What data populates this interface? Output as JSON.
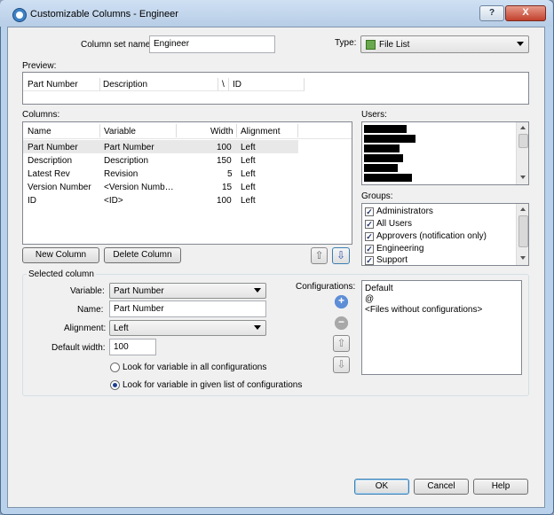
{
  "window": {
    "title": "Customizable Columns - Engineer",
    "help_glyph": "?",
    "close_glyph": "X"
  },
  "column_set": {
    "label": "Column set name:",
    "value": "Engineer"
  },
  "type": {
    "label": "Type:",
    "value": "File List",
    "icon": "file-list-icon"
  },
  "preview": {
    "label": "Preview:",
    "headers": [
      "Part Number",
      "Description",
      "\\",
      "ID"
    ]
  },
  "columns": {
    "label": "Columns:",
    "headers": [
      "Name",
      "Variable",
      "Width",
      "Alignment"
    ],
    "rows": [
      {
        "name": "Part Number",
        "variable": "Part Number",
        "width": "100",
        "alignment": "Left"
      },
      {
        "name": "Description",
        "variable": "Description",
        "width": "150",
        "alignment": "Left"
      },
      {
        "name": "Latest Rev",
        "variable": "Revision",
        "width": "5",
        "alignment": "Left"
      },
      {
        "name": "Version Number",
        "variable": "<Version Numb…",
        "width": "15",
        "alignment": "Left"
      },
      {
        "name": "ID",
        "variable": "<ID>",
        "width": "100",
        "alignment": "Left"
      }
    ]
  },
  "buttons": {
    "new_column": "New Column",
    "delete_column": "Delete Column",
    "ok": "OK",
    "cancel": "Cancel",
    "help": "Help"
  },
  "users": {
    "label": "Users:"
  },
  "groups": {
    "label": "Groups:",
    "items": [
      "Administrators",
      "All Users",
      "Approvers (notification only)",
      "Engineering",
      "Support"
    ]
  },
  "selected_column": {
    "label": "Selected column",
    "variable_label": "Variable:",
    "variable_value": "Part Number",
    "name_label": "Name:",
    "name_value": "Part Number",
    "alignment_label": "Alignment:",
    "alignment_value": "Left",
    "width_label": "Default width:",
    "width_value": "100",
    "radio_all": "Look for variable in all configurations",
    "radio_list": "Look for variable in given list of configurations"
  },
  "configurations": {
    "label": "Configurations:",
    "items": [
      "Default",
      "@",
      "<Files without configurations>"
    ]
  },
  "colors": {
    "selected_row": "#e8e8e8",
    "accent": "#3c7fb1"
  }
}
